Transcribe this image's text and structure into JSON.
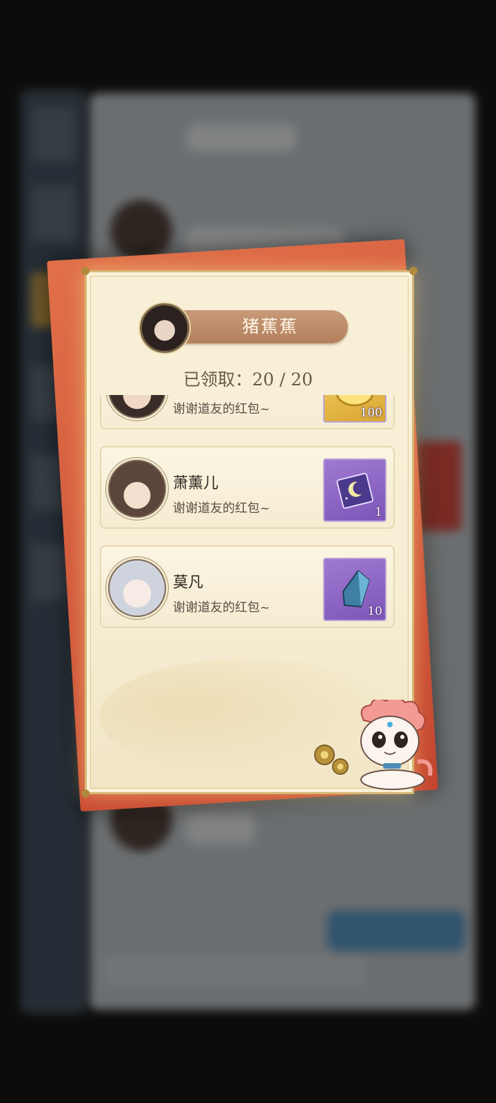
{
  "background": {
    "description_hidden": true
  },
  "card": {
    "owner_name": "猪蕉蕉",
    "claimed_label": "已领取：",
    "claimed_count": "20 / 20"
  },
  "recipients": [
    {
      "name": "",
      "message": "谢谢道友的红包~",
      "reward_qty": "100",
      "reward_icon": "gold-ingot-icon"
    },
    {
      "name": "萧薰儿",
      "message": "谢谢道友的红包~",
      "reward_qty": "1",
      "reward_icon": "moon-talisman-icon"
    },
    {
      "name": "莫凡",
      "message": "谢谢道友的红包~",
      "reward_qty": "10",
      "reward_icon": "blue-crystal-icon"
    }
  ],
  "colors": {
    "envelope": "#c5452f",
    "card_bg": "#f6eed5",
    "ribbon": "#b3805d",
    "item_purple": "#7d55b8"
  }
}
